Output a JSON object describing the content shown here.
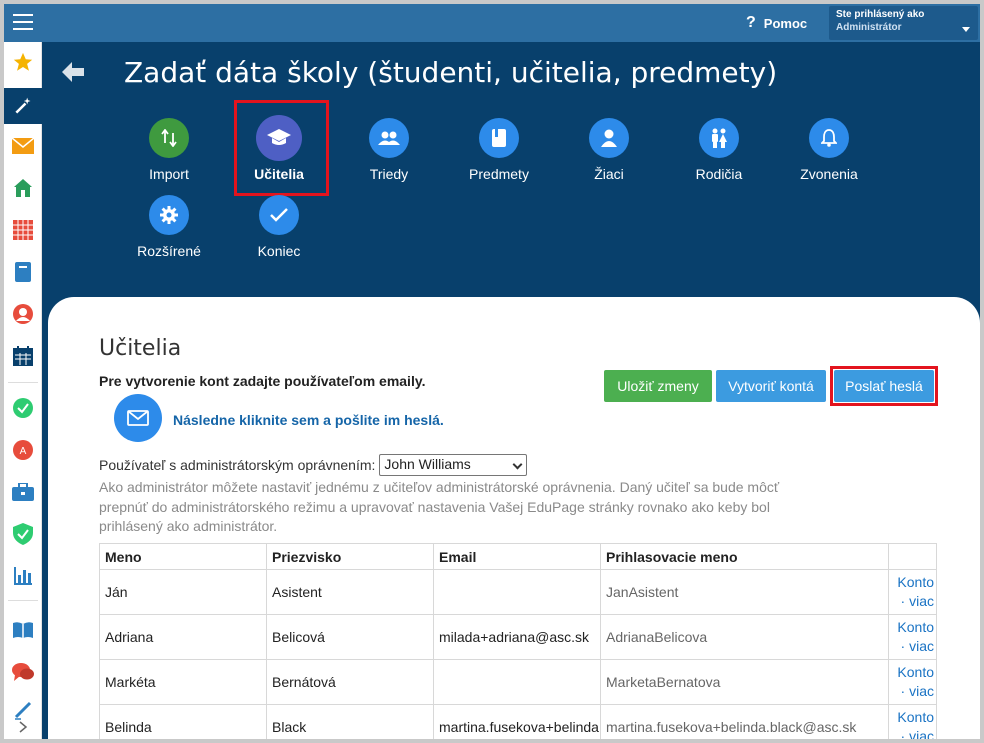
{
  "topbar": {
    "menu_icon": "hamburger-icon",
    "help_label": "Pomoc",
    "account_line1": "Ste prihlásený ako",
    "account_line2": "Administrátor"
  },
  "sidebar": {
    "items": [
      {
        "icon": "star-icon",
        "color": "#f5b301"
      },
      {
        "icon": "magic-wand-icon",
        "color": "#ffffff"
      },
      {
        "icon": "envelope-icon",
        "color": "#f39c12"
      },
      {
        "icon": "home-icon",
        "color": "#2a9d5b"
      },
      {
        "icon": "timetable-icon",
        "color": "#e74c3c"
      },
      {
        "icon": "notebook-icon",
        "color": "#2d7fc1"
      },
      {
        "icon": "student-icon",
        "color": "#e74c3c"
      },
      {
        "icon": "calendar-icon",
        "color": "#08406c"
      },
      {
        "icon": "check-circle-icon",
        "color": "#2ecc71"
      },
      {
        "icon": "grade-icon",
        "color": "#e74c3c"
      },
      {
        "icon": "briefcase-icon",
        "color": "#2d7fc1"
      },
      {
        "icon": "shield-icon",
        "color": "#2ecc71"
      },
      {
        "icon": "bar-chart-icon",
        "color": "#2d7fc1"
      },
      {
        "icon": "book-icon",
        "color": "#2d7fc1"
      },
      {
        "icon": "chat-icon",
        "color": "#e74c3c"
      },
      {
        "icon": "pen-icon",
        "color": "#2d7fc1"
      }
    ]
  },
  "header": {
    "title": "Zadať dáta školy (študenti, učitelia, predmety)"
  },
  "wizard": {
    "steps": [
      {
        "label": "Import",
        "icon": "import-arrows-icon",
        "color": "#3f9a3f"
      },
      {
        "label": "Učitelia",
        "icon": "graduation-cap-icon",
        "color": "#4e5fc4"
      },
      {
        "label": "Triedy",
        "icon": "group-icon",
        "color": "#2d8bea"
      },
      {
        "label": "Predmety",
        "icon": "book-icon",
        "color": "#2d8bea"
      },
      {
        "label": "Žiaci",
        "icon": "person-icon",
        "color": "#2d8bea"
      },
      {
        "label": "Rodičia",
        "icon": "parents-icon",
        "color": "#2d8bea"
      },
      {
        "label": "Zvonenia",
        "icon": "bell-icon",
        "color": "#2d8bea"
      },
      {
        "label": "Rozšírené",
        "icon": "gear-icon",
        "color": "#2d8bea"
      },
      {
        "label": "Koniec",
        "icon": "checkmark-icon",
        "color": "#2d8bea"
      }
    ]
  },
  "content": {
    "title": "Učitelia",
    "instruction": "Pre vytvorenie kont zadajte používateľom emaily.",
    "send_link": "Následne kliknite sem a pošlite im heslá.",
    "buttons": {
      "save": "Uložiť zmeny",
      "create": "Vytvoriť kontá",
      "send": "Poslať heslá"
    },
    "admin_label": "Používateľ s administrátorským oprávnením:",
    "admin_select": "John Williams",
    "admin_desc": "Ako administrátor môžete nastaviť jednému z učiteľov administrátorské oprávnenia. Daný učiteľ sa bude môcť prepnúť do administrátorského režimu a upravovať nastavenia Vašej EduPage stránky rovnako ako keby bol prihlásený ako administrátor."
  },
  "table": {
    "headers": [
      "Meno",
      "Priezvisko",
      "Email",
      "Prihlasovacie meno",
      ""
    ],
    "rows": [
      {
        "first": "Ján",
        "last": "Asistent",
        "email": "",
        "login": "JanAsistent",
        "a1": "Konto",
        "a2": "· viac"
      },
      {
        "first": "Adriana",
        "last": "Belicová",
        "email": "milada+adriana@asc.sk",
        "login": "AdrianaBelicova",
        "a1": "Konto",
        "a2": "· viac"
      },
      {
        "first": "Markéta",
        "last": "Bernátová",
        "email": "",
        "login": "MarketaBernatova",
        "a1": "Konto",
        "a2": "· viac"
      },
      {
        "first": "Belinda",
        "last": "Black",
        "email": "martina.fusekova+belinda.black@asc.sk",
        "login": "martina.fusekova+belinda.black@asc.sk",
        "a1": "Konto",
        "a2": "· viac"
      }
    ]
  }
}
